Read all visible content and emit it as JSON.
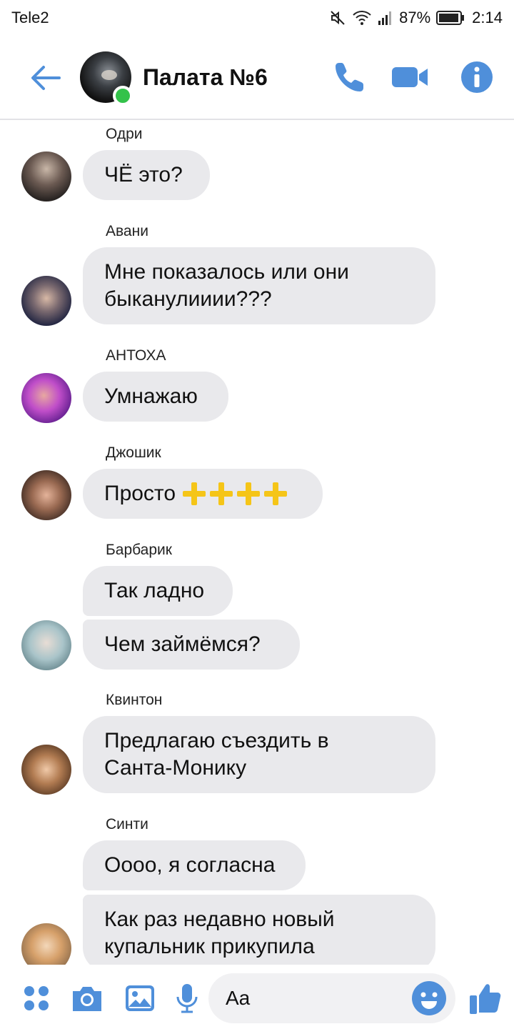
{
  "status_bar": {
    "carrier": "Tele2",
    "battery": "87%",
    "time": "2:14",
    "icons": [
      "mute-icon",
      "wifi-icon",
      "signal-icon",
      "battery-icon"
    ]
  },
  "header": {
    "title": "Палата №6",
    "online": true,
    "icons": [
      "back-arrow-icon",
      "phone-icon",
      "video-camera-icon",
      "info-icon"
    ]
  },
  "messages": [
    {
      "sender": "Одри",
      "bubbles": [
        "ЧЁ это?"
      ]
    },
    {
      "sender": "Авани",
      "bubbles": [
        "Мне показалось или они\nбыканулииии???"
      ]
    },
    {
      "sender": "АНТОХА",
      "bubbles": [
        "Умнажаю"
      ]
    },
    {
      "sender": "Джошик",
      "bubbles": [
        "Просто"
      ],
      "emoji": "++++"
    },
    {
      "sender": "Барбарик",
      "bubbles": [
        "Так ладно",
        "Чем займёмся?"
      ]
    },
    {
      "sender": "Квинтон",
      "bubbles": [
        "Предлагаю съездить в\nСанта-Монику"
      ]
    },
    {
      "sender": "Синти",
      "bubbles": [
        "Оооо, я согласна",
        "Как раз недавно новый\nкупальник прикупила"
      ]
    }
  ],
  "composer": {
    "placeholder": "Aa",
    "icons": [
      "apps-grid-icon",
      "camera-icon",
      "gallery-icon",
      "microphone-icon",
      "emoji-icon",
      "thumbs-up-icon"
    ]
  },
  "colors": {
    "accent": "#4f8fda",
    "bubble": "#e9e9ec",
    "online": "#33c24a"
  }
}
